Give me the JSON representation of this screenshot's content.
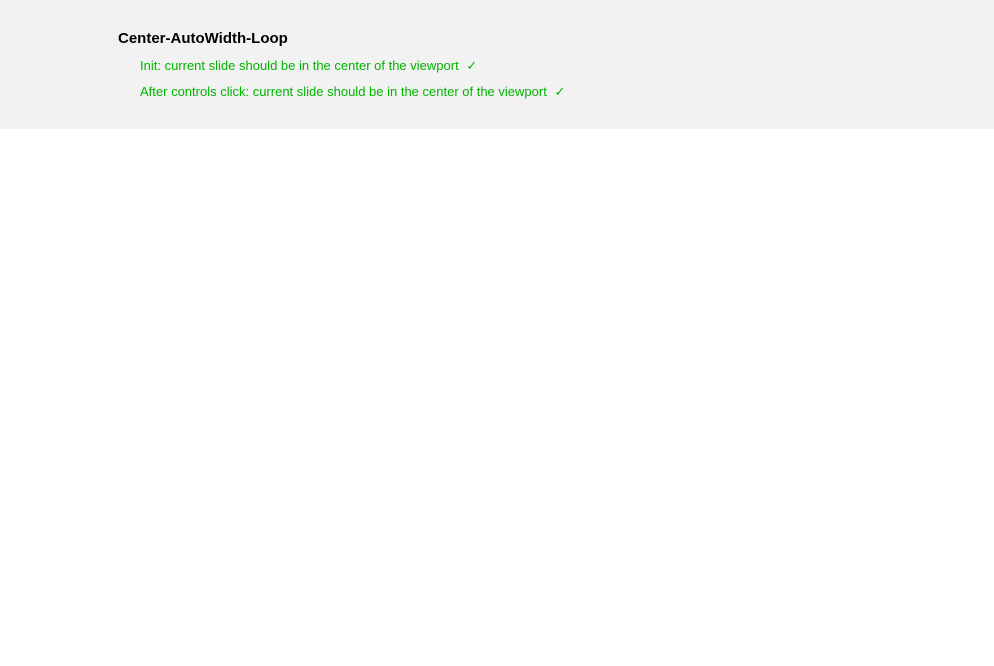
{
  "suite": {
    "title": "Center-AutoWidth-Loop",
    "tests": [
      {
        "label": "Init: current slide should be in the center of the viewport",
        "passed": true,
        "checkmark": "✓"
      },
      {
        "label": "After controls click: current slide should be in the center of the viewport",
        "passed": true,
        "checkmark": "✓"
      }
    ]
  },
  "colors": {
    "panelBg": "#f2f2f2",
    "passText": "#00b400"
  }
}
